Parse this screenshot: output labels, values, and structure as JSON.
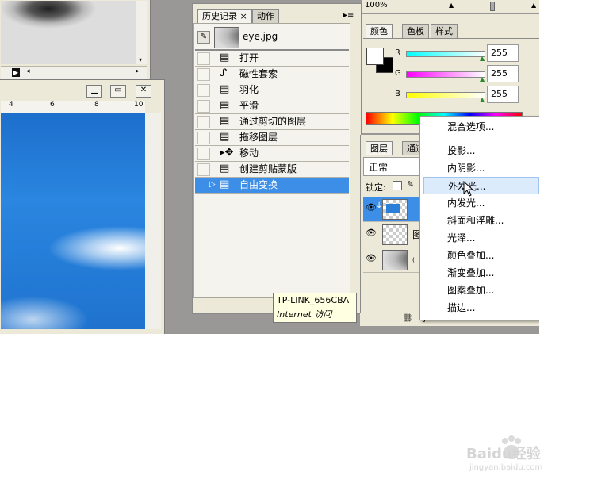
{
  "options_bar": {
    "zoom": "100%"
  },
  "history_panel": {
    "tabs": [
      "历史记录",
      "动作"
    ],
    "snapshot_name": "eye.jpg",
    "items": [
      "打开",
      "磁性套索",
      "羽化",
      "平滑",
      "通过剪切的图层",
      "拖移图层",
      "移动",
      "创建剪贴蒙版",
      "自由变换"
    ],
    "selected_index": 8
  },
  "color_panel": {
    "tabs": [
      "颜色",
      "色板",
      "样式"
    ],
    "r_label": "R",
    "g_label": "G",
    "b_label": "B",
    "r_value": "255",
    "g_value": "255",
    "b_value": "255"
  },
  "layers_panel": {
    "tabs": [
      "图层",
      "通道"
    ],
    "blend_mode": "正常",
    "lock_label": "锁定:",
    "layer_label_partial_1": "图",
    "layer_label_partial_2": "₍"
  },
  "context_menu": {
    "items": [
      "混合选项...",
      "投影...",
      "内阴影...",
      "外发光...",
      "内发光...",
      "斜面和浮雕...",
      "光泽...",
      "颜色叠加...",
      "渐变叠加...",
      "图案叠加...",
      "描边..."
    ],
    "highlighted_index": 3
  },
  "tooltip": {
    "title": "TP-LINK_656CBA",
    "subtitle": "Internet 访问"
  },
  "ruler": {
    "labels": [
      "4",
      "6",
      "8",
      "10"
    ]
  },
  "watermark": {
    "text": "Baidu经验",
    "url": "jingyan.baidu.com"
  }
}
